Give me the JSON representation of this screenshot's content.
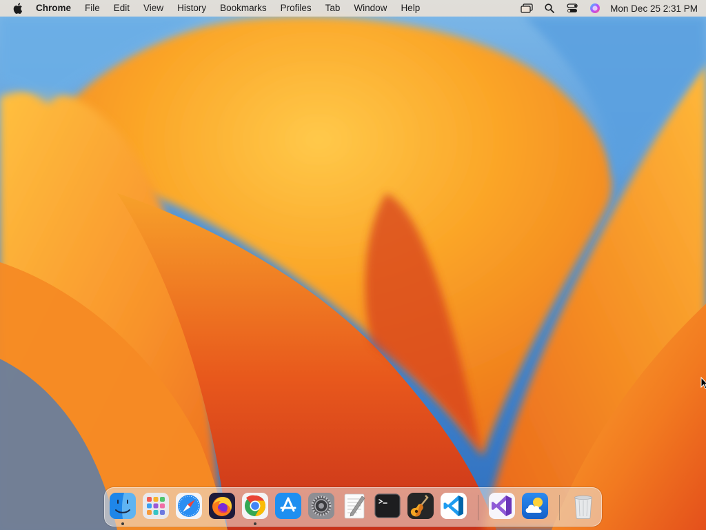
{
  "menubar": {
    "app_name": "Chrome",
    "items": [
      "File",
      "Edit",
      "View",
      "History",
      "Bookmarks",
      "Profiles",
      "Tab",
      "Window",
      "Help"
    ],
    "status_icons": [
      "window-overview-icon",
      "spotlight-search-icon",
      "control-center-icon",
      "siri-icon"
    ],
    "clock": "Mon Dec 25  2:31 PM"
  },
  "dock": {
    "apps": [
      {
        "name": "Finder",
        "icon": "finder-icon",
        "running": true
      },
      {
        "name": "Launchpad",
        "icon": "launchpad-icon",
        "running": false
      },
      {
        "name": "Safari",
        "icon": "safari-icon",
        "running": false
      },
      {
        "name": "Firefox",
        "icon": "firefox-icon",
        "running": false
      },
      {
        "name": "Google Chrome",
        "icon": "chrome-icon",
        "running": true
      },
      {
        "name": "App Store",
        "icon": "app-store-icon",
        "running": false
      },
      {
        "name": "System Settings",
        "icon": "settings-gear-icon",
        "running": false
      },
      {
        "name": "TextEdit",
        "icon": "textedit-icon",
        "running": false
      },
      {
        "name": "Terminal",
        "icon": "terminal-icon",
        "running": false
      },
      {
        "name": "GarageBand",
        "icon": "garageband-guitar-icon",
        "running": false
      },
      {
        "name": "Visual Studio Code",
        "icon": "vscode-icon",
        "running": false
      },
      {
        "name": "Visual Studio",
        "icon": "visual-studio-icon",
        "running": false
      },
      {
        "name": "Weather",
        "icon": "weather-icon",
        "running": false
      },
      {
        "name": "Trash",
        "icon": "trash-icon",
        "running": false
      }
    ]
  },
  "colors": {
    "wallpaper_blue": "#3d7fc9",
    "wallpaper_orange": "#f6921e",
    "wallpaper_deep": "#e0451a",
    "menubar_bg": "#eee2d6"
  }
}
